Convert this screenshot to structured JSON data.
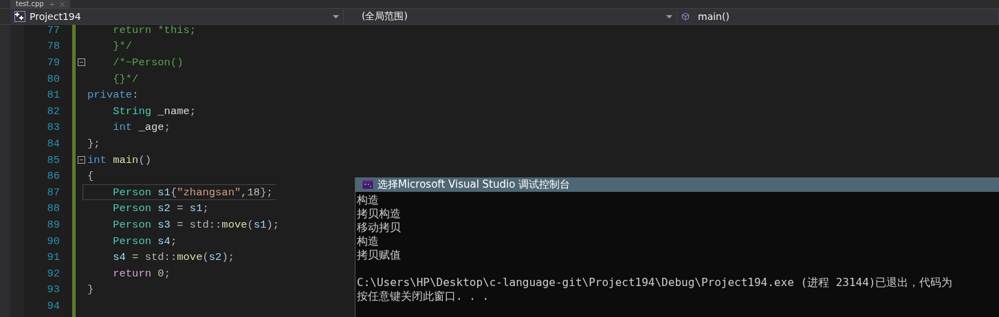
{
  "document_tab": {
    "label": "test.cpp",
    "selected": true
  },
  "navigation_bar": {
    "project": "Project194",
    "scope": "(全局范围)",
    "member": "main()"
  },
  "editor": {
    "lines": [
      {
        "number": "77",
        "fold_marker": false,
        "current": false,
        "tokens": [
          {
            "kind": "comment",
            "text": "    return *this;"
          }
        ]
      },
      {
        "number": "78",
        "fold_marker": false,
        "current": false,
        "tokens": [
          {
            "kind": "comment",
            "text": "    }*/"
          }
        ]
      },
      {
        "number": "79",
        "fold_marker": true,
        "current": false,
        "tokens": [
          {
            "kind": "comment",
            "text": "    /*~Person()"
          }
        ]
      },
      {
        "number": "80",
        "fold_marker": false,
        "current": false,
        "tokens": [
          {
            "kind": "comment",
            "text": "    {}*/"
          }
        ]
      },
      {
        "number": "81",
        "fold_marker": false,
        "current": false,
        "tokens": [
          {
            "kind": "keyword",
            "text": "private"
          },
          {
            "kind": "punct",
            "text": ":"
          }
        ]
      },
      {
        "number": "82",
        "fold_marker": false,
        "current": false,
        "tokens": [
          {
            "kind": "type",
            "text": "    String"
          },
          {
            "kind": "plain",
            "text": " _name"
          },
          {
            "kind": "punct",
            "text": ";"
          }
        ]
      },
      {
        "number": "83",
        "fold_marker": false,
        "current": false,
        "tokens": [
          {
            "kind": "keyword",
            "text": "    int"
          },
          {
            "kind": "plain",
            "text": " _age"
          },
          {
            "kind": "punct",
            "text": ";"
          }
        ]
      },
      {
        "number": "84",
        "fold_marker": false,
        "current": false,
        "tokens": [
          {
            "kind": "punct",
            "text": "};"
          }
        ]
      },
      {
        "number": "85",
        "fold_marker": true,
        "current": false,
        "tokens": [
          {
            "kind": "keyword",
            "text": "int"
          },
          {
            "kind": "function",
            "text": " main"
          },
          {
            "kind": "punct",
            "text": "()"
          }
        ]
      },
      {
        "number": "86",
        "fold_marker": false,
        "current": false,
        "tokens": [
          {
            "kind": "punct",
            "text": "{"
          }
        ]
      },
      {
        "number": "87",
        "fold_marker": false,
        "current": true,
        "tokens": [
          {
            "kind": "type",
            "text": "    Person"
          },
          {
            "kind": "variable",
            "text": " s1"
          },
          {
            "kind": "punct",
            "text": "{"
          },
          {
            "kind": "string",
            "text": "\"zhangsan\""
          },
          {
            "kind": "punct",
            "text": ","
          },
          {
            "kind": "number",
            "text": "18"
          },
          {
            "kind": "punct",
            "text": "};"
          }
        ]
      },
      {
        "number": "88",
        "fold_marker": false,
        "current": false,
        "tokens": [
          {
            "kind": "type",
            "text": "    Person"
          },
          {
            "kind": "variable",
            "text": " s2"
          },
          {
            "kind": "punct",
            "text": " = "
          },
          {
            "kind": "variable",
            "text": "s1"
          },
          {
            "kind": "punct",
            "text": ";"
          }
        ]
      },
      {
        "number": "89",
        "fold_marker": false,
        "current": false,
        "tokens": [
          {
            "kind": "type",
            "text": "    Person"
          },
          {
            "kind": "variable",
            "text": " s3"
          },
          {
            "kind": "punct",
            "text": " = std::"
          },
          {
            "kind": "function",
            "text": "move"
          },
          {
            "kind": "punct",
            "text": "("
          },
          {
            "kind": "variable",
            "text": "s1"
          },
          {
            "kind": "punct",
            "text": ");"
          }
        ]
      },
      {
        "number": "90",
        "fold_marker": false,
        "current": false,
        "tokens": [
          {
            "kind": "type",
            "text": "    Person"
          },
          {
            "kind": "variable",
            "text": " s4"
          },
          {
            "kind": "punct",
            "text": ";"
          }
        ]
      },
      {
        "number": "91",
        "fold_marker": false,
        "current": false,
        "tokens": [
          {
            "kind": "variable",
            "text": "    s4"
          },
          {
            "kind": "punct",
            "text": " = std::"
          },
          {
            "kind": "function",
            "text": "move"
          },
          {
            "kind": "punct",
            "text": "("
          },
          {
            "kind": "variable",
            "text": "s2"
          },
          {
            "kind": "punct",
            "text": ");"
          }
        ]
      },
      {
        "number": "92",
        "fold_marker": false,
        "current": false,
        "tokens": [
          {
            "kind": "control",
            "text": "    return"
          },
          {
            "kind": "number",
            "text": " 0"
          },
          {
            "kind": "punct",
            "text": ";"
          }
        ]
      },
      {
        "number": "93",
        "fold_marker": false,
        "current": false,
        "tokens": [
          {
            "kind": "punct",
            "text": "}"
          }
        ]
      },
      {
        "number": "94",
        "fold_marker": false,
        "current": false
      }
    ]
  },
  "console": {
    "title": "选择Microsoft Visual Studio 调试控制台",
    "output_blocks": [
      [
        "构造",
        "拷贝构造",
        "移动拷贝",
        "构造",
        "拷贝赋值"
      ],
      [
        "C:\\Users\\HP\\Desktop\\c-language-git\\Project194\\Debug\\Project194.exe (进程 23144)已退出，代码为",
        "按任意键关闭此窗口. . ."
      ]
    ]
  }
}
